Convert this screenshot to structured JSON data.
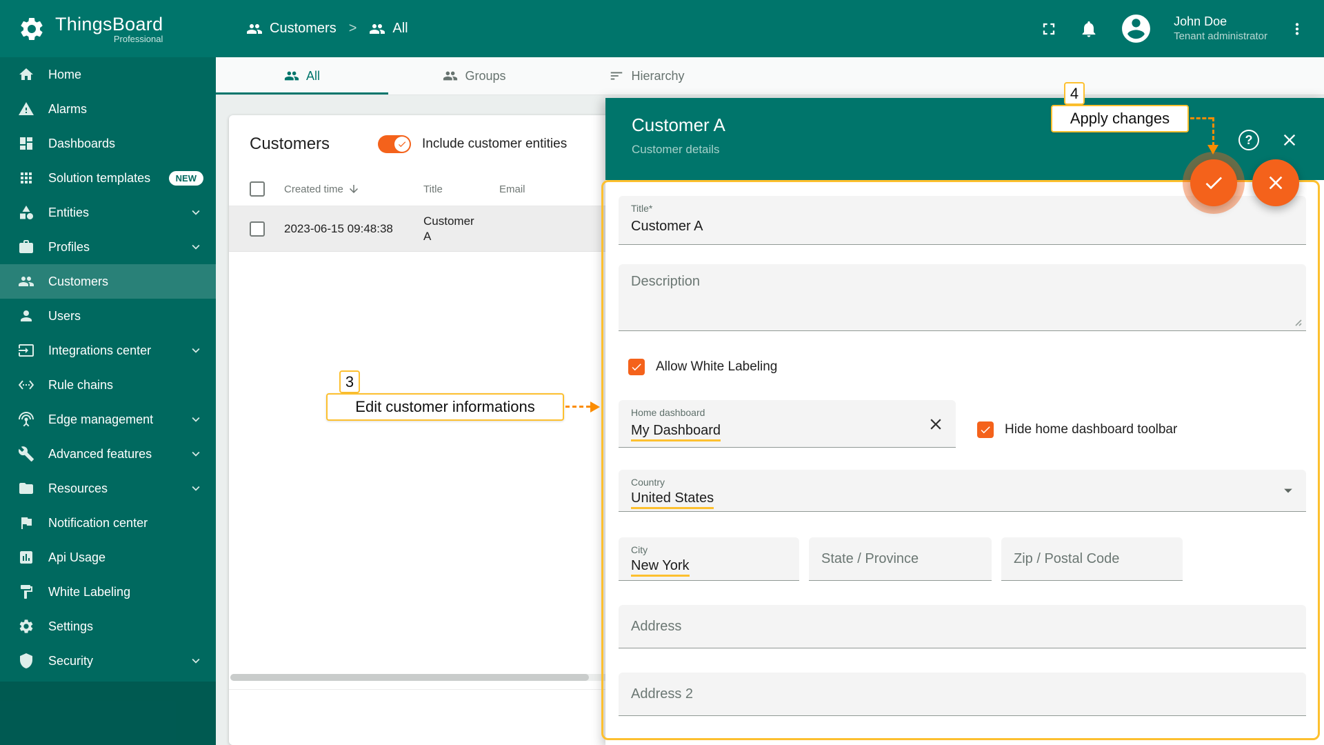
{
  "brand": {
    "name": "ThingsBoard",
    "sub": "Professional"
  },
  "header": {
    "breadcrumb": {
      "section": "Customers",
      "separator": ">",
      "page": "All"
    },
    "icons": {
      "section": "people",
      "page": "people",
      "fullscreen": "fullscreen",
      "notifications": "bell",
      "avatar": "account",
      "menu": "more-vert"
    },
    "user": {
      "name": "John Doe",
      "role": "Tenant administrator"
    }
  },
  "sidebar": {
    "items": [
      {
        "label": "Home",
        "icon": "home"
      },
      {
        "label": "Alarms",
        "icon": "warning"
      },
      {
        "label": "Dashboards",
        "icon": "dashboard"
      },
      {
        "label": "Solution templates",
        "icon": "apps",
        "badge": "NEW"
      },
      {
        "label": "Entities",
        "icon": "category"
      },
      {
        "label": "Profiles",
        "icon": "work"
      },
      {
        "label": "Customers",
        "icon": "people"
      },
      {
        "label": "Users",
        "icon": "person"
      },
      {
        "label": "Integrations center",
        "icon": "input"
      },
      {
        "label": "Rule chains",
        "icon": "ethernet"
      },
      {
        "label": "Edge management",
        "icon": "antenna"
      },
      {
        "label": "Advanced features",
        "icon": "build"
      },
      {
        "label": "Resources",
        "icon": "folder"
      },
      {
        "label": "Notification center",
        "icon": "flag"
      },
      {
        "label": "Api Usage",
        "icon": "assessment"
      },
      {
        "label": "White Labeling",
        "icon": "paint"
      },
      {
        "label": "Settings",
        "icon": "settings"
      },
      {
        "label": "Security",
        "icon": "shield"
      }
    ]
  },
  "tabs": {
    "all": "All",
    "groups": "Groups",
    "hierarchy": "Hierarchy",
    "icons": {
      "all": "people",
      "groups": "people",
      "hierarchy": "sort"
    }
  },
  "table": {
    "title": "Customers",
    "toggle": "Include customer entities",
    "col_created": "Created time",
    "col_title": "Title",
    "col_email": "Email",
    "sort_icon": "arrow-down",
    "row": {
      "created": "2023-06-15 09:48:38",
      "title": "Customer A"
    }
  },
  "drawer": {
    "title": "Customer A",
    "subtitle": "Customer details",
    "help": "?",
    "icons": {
      "close": "close",
      "apply": "check",
      "cancel": "close",
      "clear": "close",
      "dropdown": "caret"
    },
    "title_field": {
      "label": "Title*",
      "value": "Customer A"
    },
    "description": {
      "placeholder": "Description"
    },
    "allow_wl": "Allow White Labeling",
    "home_dashboard": {
      "label": "Home dashboard",
      "value": "My Dashboard"
    },
    "hide_toolbar": "Hide home dashboard toolbar",
    "country": {
      "label": "Country",
      "value": "United States"
    },
    "city": {
      "label": "City",
      "value": "New York"
    },
    "state_ph": "State / Province",
    "zip_ph": "Zip / Postal Code",
    "address_ph": "Address",
    "address2_ph": "Address 2"
  },
  "annotations": {
    "step3": {
      "num": "3",
      "label": "Edit customer informations"
    },
    "step4": {
      "num": "4",
      "label": "Apply changes"
    }
  },
  "colors": {
    "teal": "#00756b",
    "sidebar": "#00695f",
    "accent_orange": "#f4621b",
    "annotation_yellow": "#fdc02f",
    "annotation_line": "#fb8c00"
  }
}
